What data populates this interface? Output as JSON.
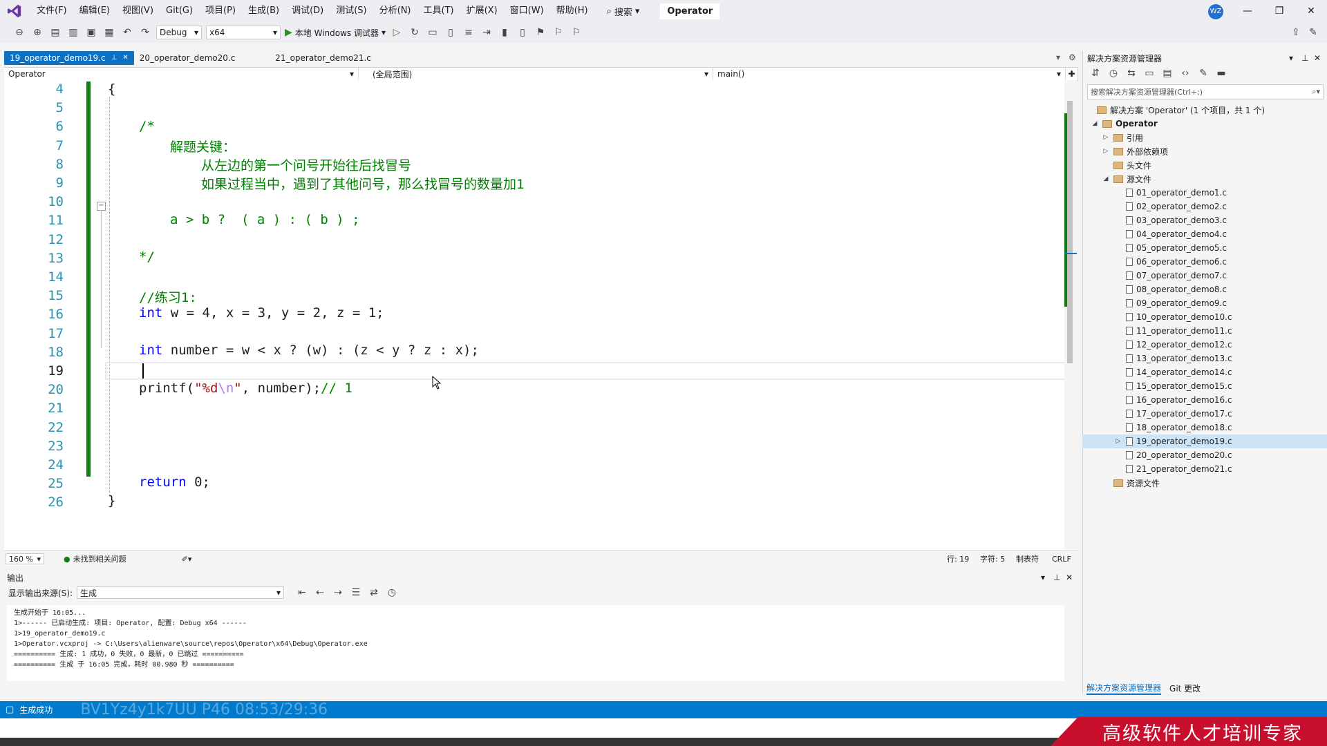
{
  "menu": {
    "items": [
      "文件(F)",
      "编辑(E)",
      "视图(V)",
      "Git(G)",
      "项目(P)",
      "生成(B)",
      "调试(D)",
      "测试(S)",
      "分析(N)",
      "工具(T)",
      "扩展(X)",
      "窗口(W)",
      "帮助(H)"
    ],
    "search_label": "搜索",
    "solution_name": "Operator",
    "avatar_initials": "WZ"
  },
  "toolbar": {
    "config": "Debug",
    "platform": "x64",
    "run_label": "本地 Windows 调试器"
  },
  "tabs": [
    {
      "label": "19_operator_demo19.c",
      "active": true
    },
    {
      "label": "20_operator_demo20.c",
      "active": false
    },
    {
      "label": "21_operator_demo21.c",
      "active": false
    }
  ],
  "navbar": {
    "project": "Operator",
    "scope": "(全局范围)",
    "member": "main()"
  },
  "editor": {
    "line_numbers": [
      "4",
      "5",
      "6",
      "7",
      "8",
      "9",
      "10",
      "11",
      "12",
      "13",
      "14",
      "15",
      "16",
      "17",
      "18",
      "19",
      "20",
      "21",
      "22",
      "23",
      "24",
      "25",
      "26"
    ],
    "current_line": "19",
    "code": {
      "l4": "{",
      "l6": "/*",
      "l7": "解题关键：",
      "l8": "从左边的第一个问号开始往后找冒号",
      "l9": "如果过程当中，遇到了其他问号，那么找冒号的数量加1",
      "l11": "a > b ?  ( a ) : ( b ) ;",
      "l13": "*/",
      "l15": "//练习1:",
      "l16_kw": "int",
      "l16_rest": " w = 4, x = 3, y = 2, z = 1;",
      "l18_kw": "int",
      "l18_rest": " number = w < x ? (w) : (z < y ? z : x);",
      "l20_fn": "printf(",
      "l20_str1": "\"%d",
      "l20_esc": "\\n",
      "l20_str2": "\"",
      "l20_rest": ", number);",
      "l20_comment": "// 1",
      "l25_kw": "return",
      "l25_rest": " 0;",
      "l26": "}"
    },
    "zoom": "160 %",
    "issues": "未找到相关问题",
    "cursor_line": "行: 19",
    "cursor_char": "字符: 5",
    "indent": "制表符",
    "eol": "CRLF"
  },
  "output": {
    "title": "输出",
    "source_label": "显示输出来源(S):",
    "source_value": "生成",
    "lines": [
      "生成开始于 16:05...",
      "1>------ 已启动生成: 项目: Operator, 配置: Debug x64 ------",
      "1>19_operator_demo19.c",
      "1>Operator.vcxproj -> C:\\Users\\alienware\\source\\repos\\Operator\\x64\\Debug\\Operator.exe",
      "========== 生成: 1 成功，0 失败，0 最新，0 已跳过 ==========",
      "========== 生成 于 16:05 完成，耗时 00.980 秒 =========="
    ]
  },
  "solution_explorer": {
    "title": "解决方案资源管理器",
    "search_placeholder": "搜索解决方案资源管理器(Ctrl+;)",
    "solution_label": "解决方案 'Operator' (1 个项目，共 1 个)",
    "project": "Operator",
    "references": "引用",
    "external_deps": "外部依赖项",
    "header_files": "头文件",
    "source_files": "源文件",
    "resource_files": "资源文件",
    "files": [
      "01_operator_demo1.c",
      "02_operator_demo2.c",
      "03_operator_demo3.c",
      "04_operator_demo4.c",
      "05_operator_demo5.c",
      "06_operator_demo6.c",
      "07_operator_demo7.c",
      "08_operator_demo8.c",
      "09_operator_demo9.c",
      "10_operator_demo10.c",
      "11_operator_demo11.c",
      "12_operator_demo12.c",
      "13_operator_demo13.c",
      "14_operator_demo14.c",
      "15_operator_demo15.c",
      "16_operator_demo16.c",
      "17_operator_demo17.c",
      "18_operator_demo18.c",
      "19_operator_demo19.c",
      "20_operator_demo20.c",
      "21_operator_demo21.c"
    ],
    "selected_file": "19_operator_demo19.c",
    "bottom_tabs": [
      "解决方案资源管理器",
      "Git 更改"
    ]
  },
  "statusbar": {
    "text": "生成成功"
  },
  "watermark": {
    "banner": "高级软件人才培训专家",
    "overlay": "BV1Yz4y1k7UU P46 08:53/29:36"
  },
  "colors": {
    "accent": "#007acc",
    "active_tab": "#0e70c0",
    "change_bar": "#107c10",
    "comment": "#008000",
    "keyword": "#0000ff",
    "banner": "#c8102e"
  }
}
